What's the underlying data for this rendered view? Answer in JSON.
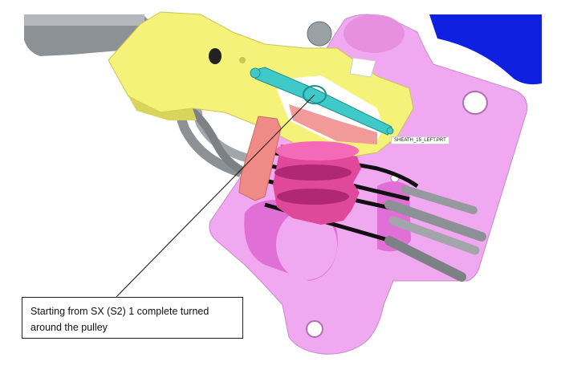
{
  "model": {
    "part_label": "SHEATH_15_LEFT.PRT"
  },
  "annotation": {
    "text": "Starting from SX (S2) 1 complete turned around the pulley"
  },
  "colors": {
    "background": "#ffffff",
    "housing_pink": "#f0a8f0",
    "bracket_yellow": "#f5f27a",
    "pulley_magenta": "#e0489a",
    "washer_salmon": "#f08a86",
    "sheath_cyan": "#3fc9c9",
    "blue_part": "#1020e0",
    "gray_part": "#8c9196",
    "cable_black": "#111111"
  }
}
